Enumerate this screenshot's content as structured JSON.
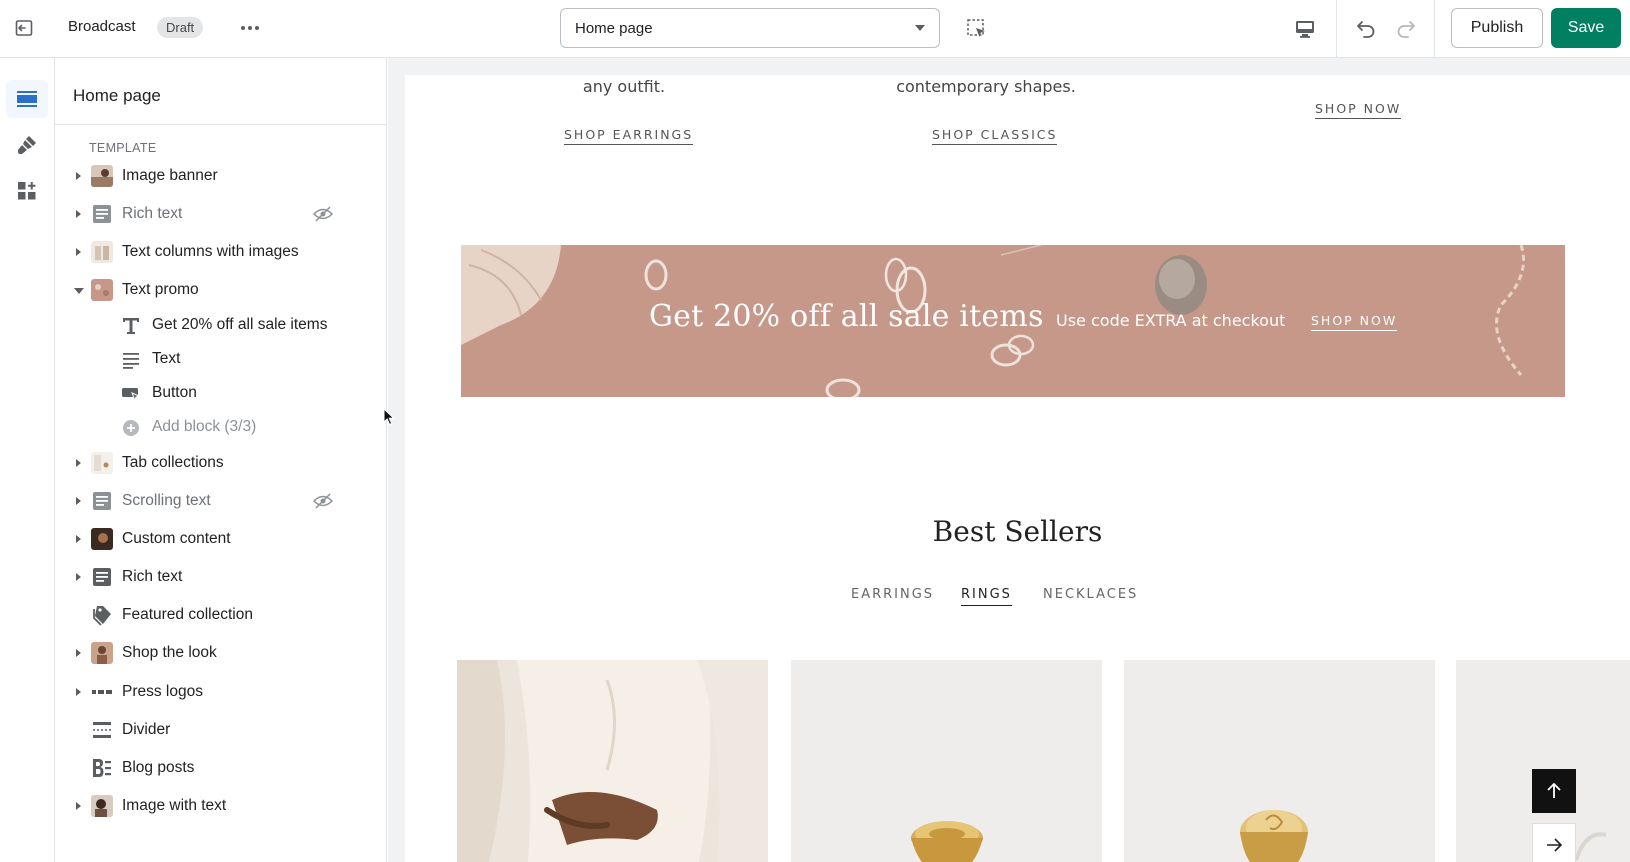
{
  "topbar": {
    "theme_name": "Broadcast",
    "status_badge": "Draft",
    "page_select": "Home page",
    "publish_label": "Publish",
    "save_label": "Save"
  },
  "rail": {
    "items": [
      {
        "icon": "sections-icon",
        "active": true
      },
      {
        "icon": "theme-settings-icon",
        "active": false
      },
      {
        "icon": "app-embeds-icon",
        "active": false
      }
    ]
  },
  "sidebar": {
    "title": "Home page",
    "section_label": "TEMPLATE",
    "sections": [
      {
        "label": "Image banner",
        "expandable": true,
        "hidden": false,
        "icon": "image-banner-thumb"
      },
      {
        "label": "Rich text",
        "expandable": true,
        "hidden": true,
        "icon": "rich-text-icon"
      },
      {
        "label": "Text columns with images",
        "expandable": true,
        "hidden": false,
        "icon": "text-columns-thumb"
      },
      {
        "label": "Text promo",
        "expandable": true,
        "expanded": true,
        "hidden": false,
        "icon": "text-promo-thumb"
      },
      {
        "label": "Tab collections",
        "expandable": true,
        "hidden": false,
        "icon": "tab-collections-thumb"
      },
      {
        "label": "Scrolling text",
        "expandable": true,
        "hidden": true,
        "icon": "rich-text-icon"
      },
      {
        "label": "Custom content",
        "expandable": true,
        "hidden": false,
        "icon": "custom-content-thumb"
      },
      {
        "label": "Rich text",
        "expandable": true,
        "hidden": false,
        "icon": "rich-text-icon"
      },
      {
        "label": "Featured collection",
        "expandable": false,
        "hidden": false,
        "icon": "collection-tag-icon"
      },
      {
        "label": "Shop the look",
        "expandable": true,
        "hidden": false,
        "icon": "shop-look-thumb"
      },
      {
        "label": "Press logos",
        "expandable": true,
        "hidden": false,
        "icon": "press-logos-thumb"
      },
      {
        "label": "Divider",
        "expandable": false,
        "hidden": false,
        "icon": "divider-icon"
      },
      {
        "label": "Blog posts",
        "expandable": false,
        "hidden": false,
        "icon": "blog-posts-icon"
      },
      {
        "label": "Image with text",
        "expandable": true,
        "hidden": false,
        "icon": "image-with-text-thumb"
      }
    ],
    "blocks": [
      {
        "label": "Get 20% off all sale items",
        "icon": "heading-icon"
      },
      {
        "label": "Text",
        "icon": "text-lines-icon"
      },
      {
        "label": "Button",
        "icon": "button-icon"
      },
      {
        "label": "Add block (3/3)",
        "icon": "add-circle-icon"
      }
    ]
  },
  "preview": {
    "col1_text": "any outfit.",
    "col2_text": "contemporary shapes.",
    "col1_link": "SHOP EARRINGS",
    "col2_link": "SHOP CLASSICS",
    "col3_link": "SHOP NOW",
    "promo": {
      "heading": "Get 20% off all sale items",
      "text": "Use code EXTRA at checkout",
      "link": "SHOP NOW",
      "bg_color": "#c6988a"
    },
    "best_sellers_title": "Best Sellers",
    "tabs": [
      "EARRINGS",
      "RINGS",
      "NECKLACES"
    ],
    "active_tab": "RINGS"
  },
  "colors": {
    "accent": "#008060",
    "border": "#e1e3e5",
    "preview_bg": "#f1f2f3"
  }
}
